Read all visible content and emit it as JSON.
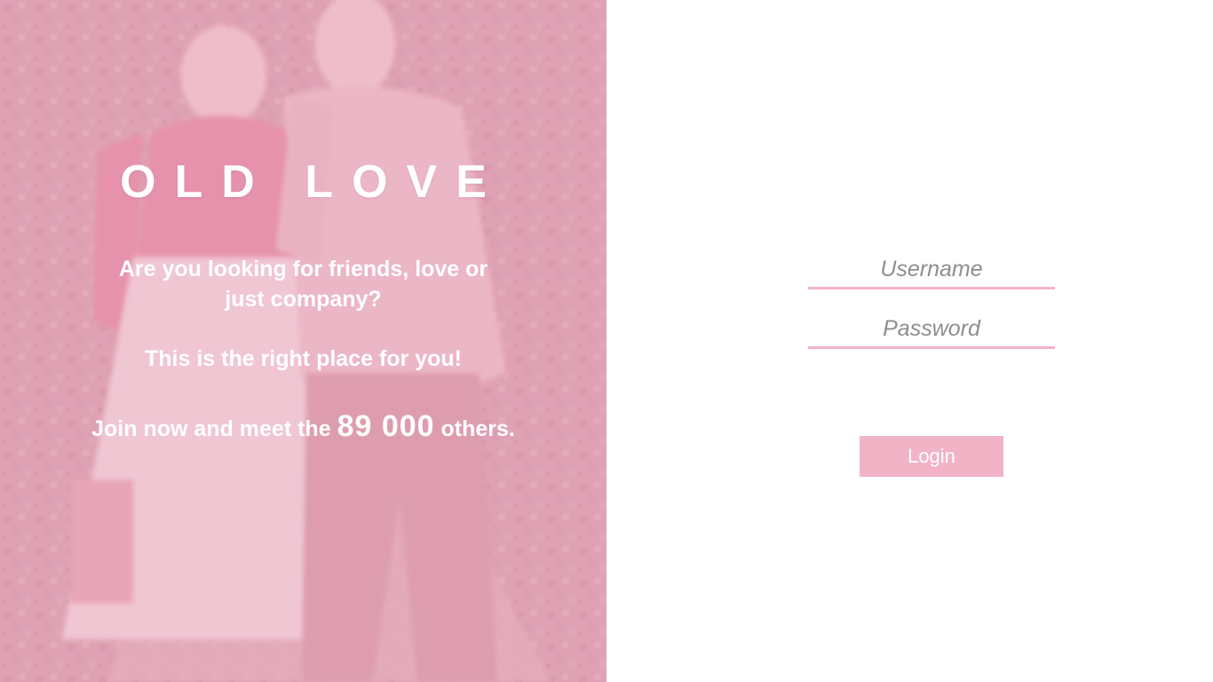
{
  "hero": {
    "brand": "OLD LOVE",
    "tagline_line1": "Are you looking for friends, love or just company?",
    "tagline_line2": "This is the right place for you!",
    "join_prefix": "Join now and meet the",
    "join_count": "89 000",
    "join_suffix": "others.",
    "photo": "elderly-couple-walking-photo"
  },
  "login": {
    "username_placeholder": "Username",
    "password_placeholder": "Password",
    "button_label": "Login"
  },
  "colors": {
    "accent_pink": "#f2b3c7",
    "hero_tint": "#eca0b6",
    "text_white": "#ffffff",
    "placeholder_gray": "#8e8e8e"
  }
}
